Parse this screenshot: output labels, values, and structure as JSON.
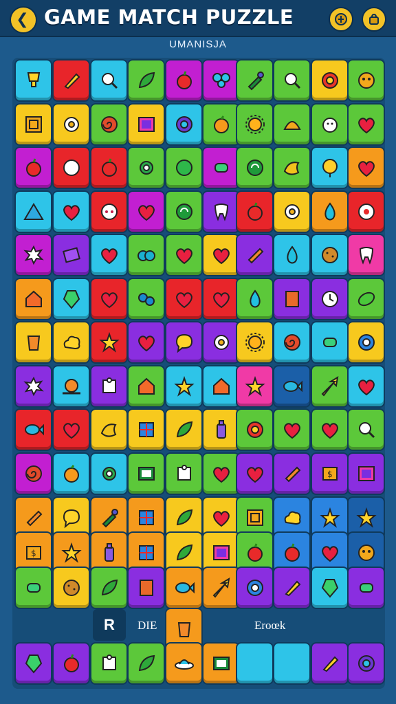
{
  "header": {
    "title": "GAME MATCH PUZZLE",
    "subtitle": "UMANISJA",
    "back_icon": "back-arrow-icon",
    "right_icons": [
      "coin-icon",
      "shop-bag-icon"
    ]
  },
  "palette": {
    "cyan": "#2ec4e8",
    "red": "#e8252a",
    "green": "#5cc83a",
    "magenta": "#c21fd1",
    "yellow": "#f7c91e",
    "orange": "#f59a1c",
    "purple": "#8a2ee0",
    "pink": "#f03aa6",
    "blue": "#2b84e0",
    "lime": "#8bd728",
    "darkblue": "#1b5fa8",
    "board": "#164d78"
  },
  "board": {
    "rows": [
      [
        "cyan:trophy",
        "red:pencil",
        "cyan:magnifier",
        "green:leaf",
        "magenta:apple",
        "magenta:butterfly",
        "green:pipette",
        "green:magnifier",
        "yellow:target",
        "green:face"
      ],
      [
        "yellow:box",
        "yellow:flower",
        "green:spiral",
        "yellow:frame",
        "cyan:ring",
        "green:orange",
        "green:sun",
        "green:shell",
        "green:chick",
        "green:heart"
      ],
      [
        "magenta:apple",
        "red:pearl",
        "red:apple",
        "green:gear",
        "green:ball",
        "magenta:candy",
        "green:swirl",
        "green:bird",
        "cyan:balloon",
        "orange:heart"
      ],
      [
        "cyan:mountain",
        "cyan:heart",
        "red:mask",
        "magenta:heart",
        "green:swirl",
        "purple:tooth",
        "red:apple",
        "yellow:flower",
        "orange:drop",
        "red:eye"
      ],
      [
        "magenta:splat",
        "purple:card",
        "cyan:heart",
        "green:hearts",
        "green:heart",
        "yellow:heart",
        "purple:carrot",
        "cyan:drop",
        "cyan:cookie",
        "pink:tooth"
      ],
      [
        "orange:house",
        "cyan:gem",
        "red:heart",
        "green:bubbles",
        "red:heart",
        "red:heart",
        "green:drop",
        "purple:book",
        "purple:clock",
        "green:lemon"
      ],
      [
        "yellow:cup",
        "yellow:cloud",
        "red:star",
        "purple:heart",
        "purple:bubble",
        "purple:flower",
        "yellow:sun",
        "cyan:spiral",
        "cyan:candy",
        "yellow:coin"
      ],
      [
        "purple:splat",
        "cyan:snail",
        "purple:puzzle",
        "green:house",
        "cyan:star",
        "cyan:house",
        "pink:star",
        "darkblue:fish",
        "green:arrow",
        "cyan:heart"
      ],
      [
        "red:fish",
        "red:heart",
        "yellow:bird",
        "yellow:window",
        "yellow:leaf",
        "yellow:bottle",
        "green:target",
        "green:heart",
        "green:heart",
        "green:magnifier"
      ],
      [
        "magenta:spiral",
        "cyan:orange",
        "cyan:gear",
        "green:screen",
        "green:puzzle",
        "green:heart",
        "purple:heart",
        "purple:carrot",
        "purple:ticket",
        "purple:frame"
      ]
    ],
    "bottom_labels": {
      "badge": "R",
      "text_left": "DIE",
      "text_right": "Eroœk"
    },
    "bottom_row": [
      "purple:gem",
      "purple:apple",
      "green:puzzle",
      "green:leaf",
      "orange:ufo",
      "orange:screen",
      "cyan:plain",
      "cyan:plain",
      "purple:pencil",
      "purple:ring"
    ]
  }
}
